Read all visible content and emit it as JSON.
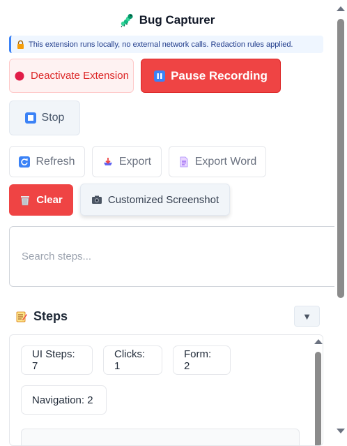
{
  "app": {
    "title": "Bug Capturer",
    "icon": "caterpillar-icon"
  },
  "notice": {
    "icon": "lock-icon",
    "text": "This extension runs locally, no external network calls. Redaction rules applied."
  },
  "controls": {
    "deactivate": {
      "label": "Deactivate Extension",
      "icon": "stop-circle-icon"
    },
    "pause": {
      "label": "Pause Recording",
      "icon": "pause-icon"
    },
    "stop": {
      "label": "Stop",
      "icon": "stop-square-icon"
    }
  },
  "actions": {
    "refresh": {
      "label": "Refresh",
      "icon": "refresh-icon"
    },
    "export": {
      "label": "Export",
      "icon": "inbox-tray-icon"
    },
    "export_word": {
      "label": "Export Word",
      "icon": "document-icon"
    },
    "clear": {
      "label": "Clear",
      "icon": "wastebasket-icon"
    },
    "screenshot": {
      "label": "Customized Screenshot",
      "icon": "camera-icon"
    }
  },
  "search": {
    "placeholder": "Search steps...",
    "value": ""
  },
  "steps": {
    "title": "Steps",
    "icon": "memo-icon",
    "collapse_symbol": "▼",
    "stats": [
      {
        "label": "UI Steps: 7"
      },
      {
        "label": "Clicks: 1"
      },
      {
        "label": "Form: 2"
      },
      {
        "label": "Navigation: 2"
      }
    ]
  },
  "colors": {
    "accent_red": "#ef4444",
    "danger_text": "#dc2626",
    "notice_bg": "#eff6ff",
    "notice_border": "#3b82f6"
  }
}
